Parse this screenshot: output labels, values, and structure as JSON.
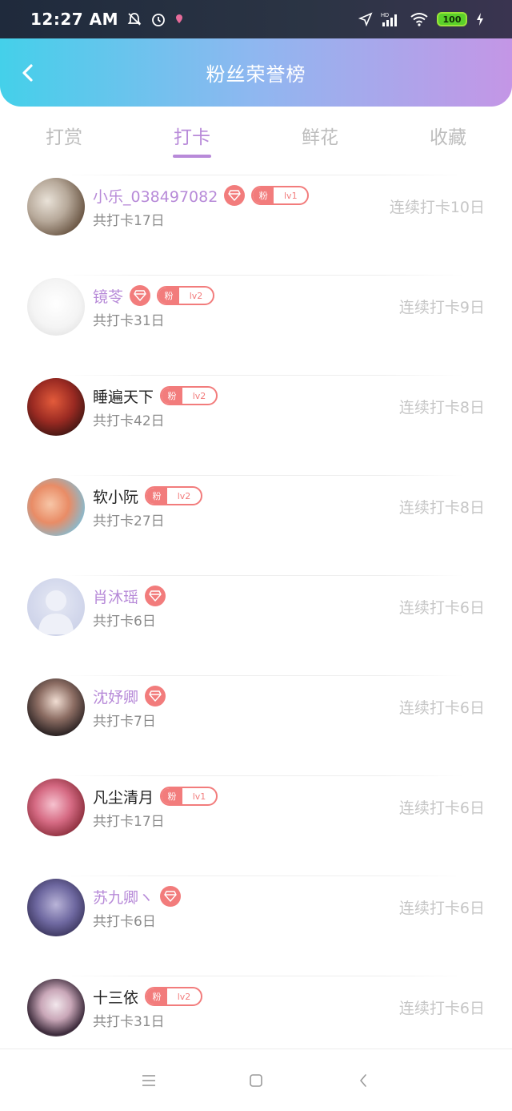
{
  "status_bar": {
    "time": "12:27 AM",
    "battery": "100",
    "network": "HD",
    "icons": [
      "mute-icon",
      "alarm-icon",
      "location-dot-icon",
      "navigation-icon",
      "signal-icon",
      "wifi-icon",
      "charging-icon"
    ]
  },
  "header": {
    "title": "粉丝荣誉榜",
    "back_icon": "chevron-left-icon"
  },
  "tabs": [
    {
      "label": "打赏",
      "active": false
    },
    {
      "label": "打卡",
      "active": true
    },
    {
      "label": "鲜花",
      "active": false
    },
    {
      "label": "收藏",
      "active": false
    }
  ],
  "colors": {
    "accent_purple": "#b88ad9",
    "badge_red": "#f27c7c",
    "header_gradient": [
      "#44d0ea",
      "#8fb7f0",
      "#c496e6"
    ]
  },
  "list": [
    {
      "name": "小乐_038497082",
      "name_purple": true,
      "diamond": true,
      "fan_badge": {
        "label": "粉",
        "level": "lv1"
      },
      "total": "共打卡17日",
      "streak": "连续打卡10日"
    },
    {
      "name": "镜苓",
      "name_purple": true,
      "diamond": true,
      "fan_badge": {
        "label": "粉",
        "level": "lv2"
      },
      "total": "共打卡31日",
      "streak": "连续打卡9日"
    },
    {
      "name": "睡遍天下",
      "name_purple": false,
      "diamond": false,
      "fan_badge": {
        "label": "粉",
        "level": "lv2"
      },
      "total": "共打卡42日",
      "streak": "连续打卡8日"
    },
    {
      "name": "软小阮",
      "name_purple": false,
      "diamond": false,
      "fan_badge": {
        "label": "粉",
        "level": "lv2"
      },
      "total": "共打卡27日",
      "streak": "连续打卡8日"
    },
    {
      "name": "肖沐瑶",
      "name_purple": true,
      "diamond": true,
      "fan_badge": null,
      "total": "共打卡6日",
      "streak": "连续打卡6日"
    },
    {
      "name": "沈妤卿",
      "name_purple": true,
      "diamond": true,
      "fan_badge": null,
      "total": "共打卡7日",
      "streak": "连续打卡6日"
    },
    {
      "name": "凡尘清月",
      "name_purple": false,
      "diamond": false,
      "fan_badge": {
        "label": "粉",
        "level": "lv1"
      },
      "total": "共打卡17日",
      "streak": "连续打卡6日"
    },
    {
      "name": "苏九卿ヽ",
      "name_purple": true,
      "diamond": true,
      "fan_badge": null,
      "total": "共打卡6日",
      "streak": "连续打卡6日"
    },
    {
      "name": "十三依",
      "name_purple": false,
      "diamond": false,
      "fan_badge": {
        "label": "粉",
        "level": "lv2"
      },
      "total": "共打卡31日",
      "streak": "连续打卡6日"
    }
  ],
  "nav_bar": {
    "buttons": [
      "menu-icon",
      "home-square-icon",
      "back-triangle-icon"
    ]
  }
}
